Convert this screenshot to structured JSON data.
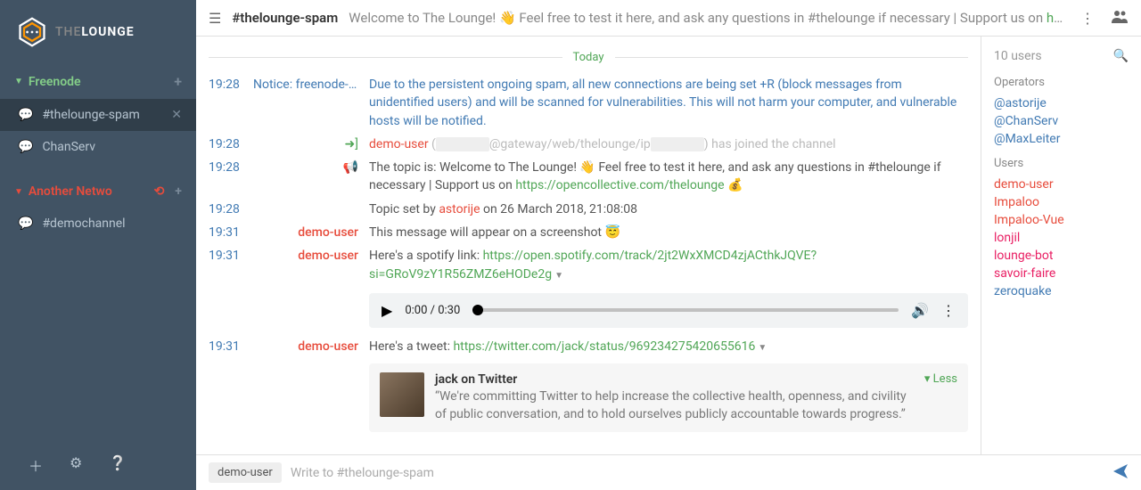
{
  "app": {
    "name": "THE",
    "name2": "LOUNGE"
  },
  "networks": [
    {
      "name": "Freenode",
      "channels": [
        {
          "name": "#thelounge-spam",
          "active": true
        },
        {
          "name": "ChanServ",
          "active": false
        }
      ]
    },
    {
      "name": "Another Netwo",
      "channels": [
        {
          "name": "#demochannel",
          "active": false
        }
      ]
    }
  ],
  "header": {
    "channel": "#thelounge-spam",
    "topic_pre": "Welcome to The Lounge! ",
    "topic_mid": " Feel free to test it here, and ask any questions in #thelounge if necessary | Support us on ",
    "topic_link": "https://op"
  },
  "divider": "Today",
  "messages": [
    {
      "ts": "19:28",
      "from": "Notice: freenode-co",
      "from_type": "notice",
      "body": "Due to the persistent ongoing spam, all new connections are being set +R (block messages from unidentified users) and will be scanned for vulnerabilities. This will not harm your computer, and vulnerable hosts will be notified.",
      "body_type": "notice"
    },
    {
      "ts": "19:28",
      "from_type": "join",
      "user": "demo-user",
      "host_pre": "(",
      "host": "@gateway/web/thelounge/ip",
      "host_post": ") has joined the channel"
    },
    {
      "ts": "19:28",
      "from_type": "topic",
      "body_pre": "The topic is: Welcome to The Lounge! ",
      "body_mid": " Feel free to test it here, and ask any questions in #thelounge if necessary | Support us on ",
      "link": "https://opencollective.com/thelounge"
    },
    {
      "ts": "19:28",
      "body_pre": "Topic set by ",
      "user": "astorije",
      "body_post": " on 26 March 2018, 21:08:08"
    },
    {
      "ts": "19:31",
      "from": "demo-user",
      "from_type": "user",
      "body": "This message will appear on a screenshot "
    },
    {
      "ts": "19:31",
      "from": "demo-user",
      "from_type": "user",
      "body_pre": "Here's a spotify link: ",
      "link": "https://open.spotify.com/track/2jt2WxXMCD4zjACthkJQVE?si=GRoV9zY1R56ZMZ6eHODe2g"
    },
    {
      "ts": "19:31",
      "from": "demo-user",
      "from_type": "user",
      "body_pre": "Here's a tweet: ",
      "link": "https://twitter.com/jack/status/969234275420655616"
    }
  ],
  "audio": {
    "time": "0:00 / 0:30"
  },
  "embed": {
    "title": "jack on Twitter",
    "body": "“We're committing Twitter to help increase the collective health, openness, and civility of public conversation, and to hold ourselves publicly accountable towards progress.”",
    "less": "▾ Less"
  },
  "userlist": {
    "count": "10 users",
    "sections": [
      {
        "title": "Operators",
        "users": [
          {
            "n": "@astorije",
            "c": "blue"
          },
          {
            "n": "@ChanServ",
            "c": "blue"
          },
          {
            "n": "@MaxLeiter",
            "c": "blue"
          }
        ]
      },
      {
        "title": "Users",
        "users": [
          {
            "n": "demo-user",
            "c": "red"
          },
          {
            "n": "Impaloo",
            "c": "red"
          },
          {
            "n": "Impaloo-Vue",
            "c": "red"
          },
          {
            "n": "lonjil",
            "c": "pink"
          },
          {
            "n": "lounge-bot",
            "c": "pink"
          },
          {
            "n": "savoir-faire",
            "c": "pink"
          },
          {
            "n": "zeroquake",
            "c": "blue"
          }
        ]
      }
    ]
  },
  "input": {
    "nick": "demo-user",
    "placeholder": "Write to #thelounge-spam"
  }
}
